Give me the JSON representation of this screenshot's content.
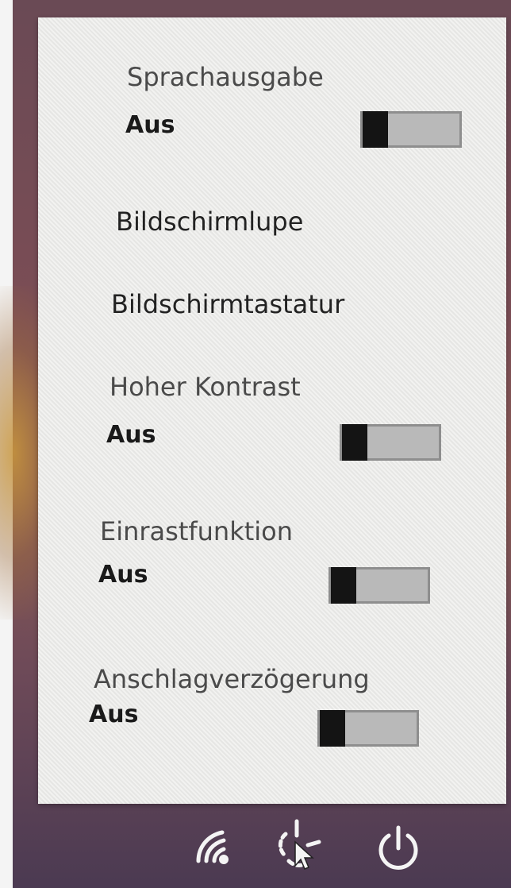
{
  "settings": {
    "narrator": {
      "title": "Sprachausgabe",
      "state": "Aus"
    },
    "magnifier": {
      "title": "Bildschirmlupe"
    },
    "onscreen_keyboard": {
      "title": "Bildschirmtastatur"
    },
    "high_contrast": {
      "title": "Hoher Kontrast",
      "state": "Aus"
    },
    "sticky_keys": {
      "title": "Einrastfunktion",
      "state": "Aus"
    },
    "filter_keys": {
      "title": "Anschlagverzögerung",
      "state": "Aus"
    }
  },
  "taskbar": {
    "icons": [
      "network-icon",
      "accessibility-icon",
      "power-icon"
    ]
  },
  "colors": {
    "panel": "#ededeb",
    "toggle_track": "#b9b9b9",
    "toggle_knob": "#141414"
  }
}
